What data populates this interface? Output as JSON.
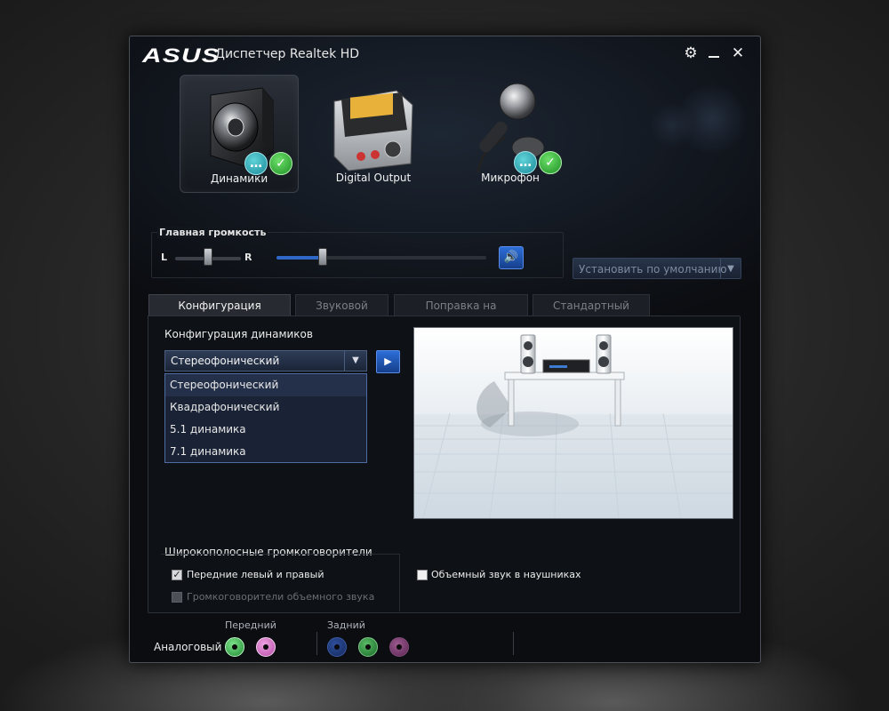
{
  "titlebar": {
    "brand": "ASUS",
    "title": "Диспетчер Realtek HD",
    "icons": [
      "gear-icon",
      "minimize-icon",
      "close-icon"
    ]
  },
  "devices": [
    {
      "label": "Динамики",
      "icon": "speaker-icon",
      "active": true,
      "status": [
        "chat-icon",
        "check-icon"
      ]
    },
    {
      "label": "Digital Output",
      "icon": "digital-output-icon",
      "active": false,
      "status": []
    },
    {
      "label": "Микрофон",
      "icon": "microphone-icon",
      "active": false,
      "status": [
        "chat-icon",
        "check-icon"
      ]
    }
  ],
  "volume": {
    "group_label": "Главная громкость",
    "left_label": "L",
    "right_label": "R",
    "balance": 0.5,
    "level": 0.22,
    "mute_icon": "speaker-volume-icon"
  },
  "default_device": {
    "label": "Установить по умолчанию",
    "icon": "chevron-down-icon"
  },
  "tabs": [
    {
      "label": "Конфигурация динамиков",
      "active": true
    },
    {
      "label": "Звуковой эффект",
      "active": false
    },
    {
      "label": "Поправка на помещение",
      "active": false
    },
    {
      "label": "Стандартный формат",
      "active": false
    }
  ],
  "speaker_config": {
    "heading": "Конфигурация динамиков",
    "selected": "Стереофонический",
    "options": [
      "Стереофонический",
      "Квадрафонический",
      "5.1 динамика",
      "7.1 динамика"
    ],
    "play_icon": "play-icon"
  },
  "fullrange": {
    "heading": "Широкополосные громкоговорители",
    "front": {
      "label": "Передние левый и правый",
      "checked": true,
      "enabled": true
    },
    "surround": {
      "label": "Громкоговорители объемного звука",
      "checked": false,
      "enabled": false
    }
  },
  "headphone_virtualization": {
    "label": "Объемный звук в наушниках",
    "checked": false
  },
  "jacks": {
    "analog_label": "Аналоговый",
    "front_label": "Передний",
    "rear_label": "Задний",
    "front": [
      "green",
      "pink"
    ],
    "rear": [
      "blue",
      "green",
      "pink"
    ]
  },
  "colors": {
    "accent_blue": "#2c6ed8",
    "status_green": "#1d8f25",
    "status_cyan": "#1c8b9a"
  }
}
